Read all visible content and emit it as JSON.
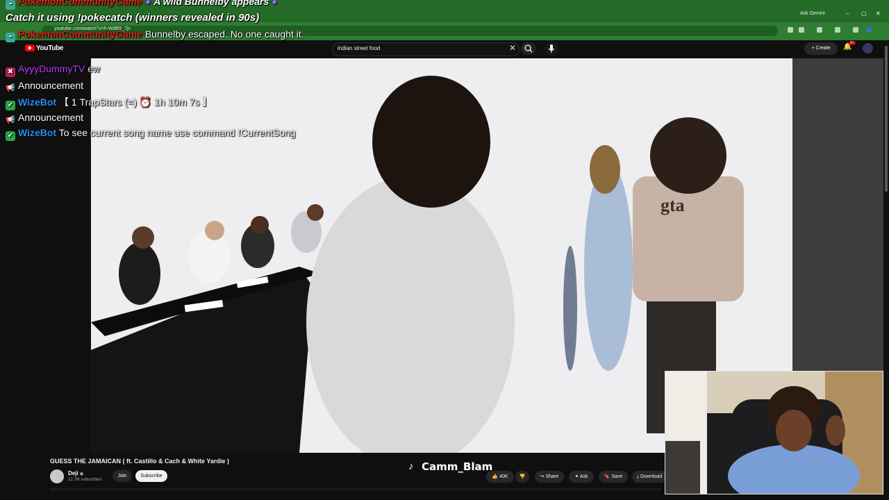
{
  "browser": {
    "url": "youtube.com/watch?v=h-WdB9_7jc",
    "ask_gemini": "Ask Gemini",
    "window_controls": [
      "–",
      "▢",
      "✕"
    ]
  },
  "youtube": {
    "logo_text": "YouTube",
    "search_value": "indian street food",
    "search_clear": "✕",
    "create_label": "+ Create",
    "notification_badge": "9+"
  },
  "video": {
    "title": "GUESS THE JAMAICAN ( ft. Castillo & Cach & White Yardie )",
    "channel": "Deji",
    "verified": "◉",
    "subscribers": "12.7M subscribers",
    "join": "Join",
    "subscribe": "Subscribe",
    "likes": "40K",
    "share": "Share",
    "ask": "Ask",
    "save": "Save",
    "download": "Download"
  },
  "overlay": {
    "tiktok_icon": "♪",
    "tiktok_handle": "Camm_Blam"
  },
  "chat": {
    "row1_user": "PokemonCommunityGame",
    "row1_text": "A wild Bunnelby appears",
    "row2_text": "Catch it using !pokecatch (winners revealed in 90s)",
    "row3_user": "PokemonCommunityGame",
    "row3_text": "Bunnelby escaped. No one caught it.",
    "row4_user": "AyyyDummyTV",
    "row4_text": "ew",
    "row5_text": "Announcement",
    "row6_user": "WizeBot",
    "row6_text_a": "【 1 TrapStars (=)",
    "row6_timer": "1h 10m 7s",
    "row6_text_b": "】",
    "row7_text": "Announcement",
    "row8_user": "WizeBot",
    "row8_text": "To see current song name use command !CurrentSong"
  },
  "colors": {
    "browser_green": "#2f7d32",
    "youtube_red": "#ff0000",
    "pokemon_user": "#e0241b",
    "ayyy_user": "#c13cff",
    "wizebot_user": "#2d8ef0"
  }
}
